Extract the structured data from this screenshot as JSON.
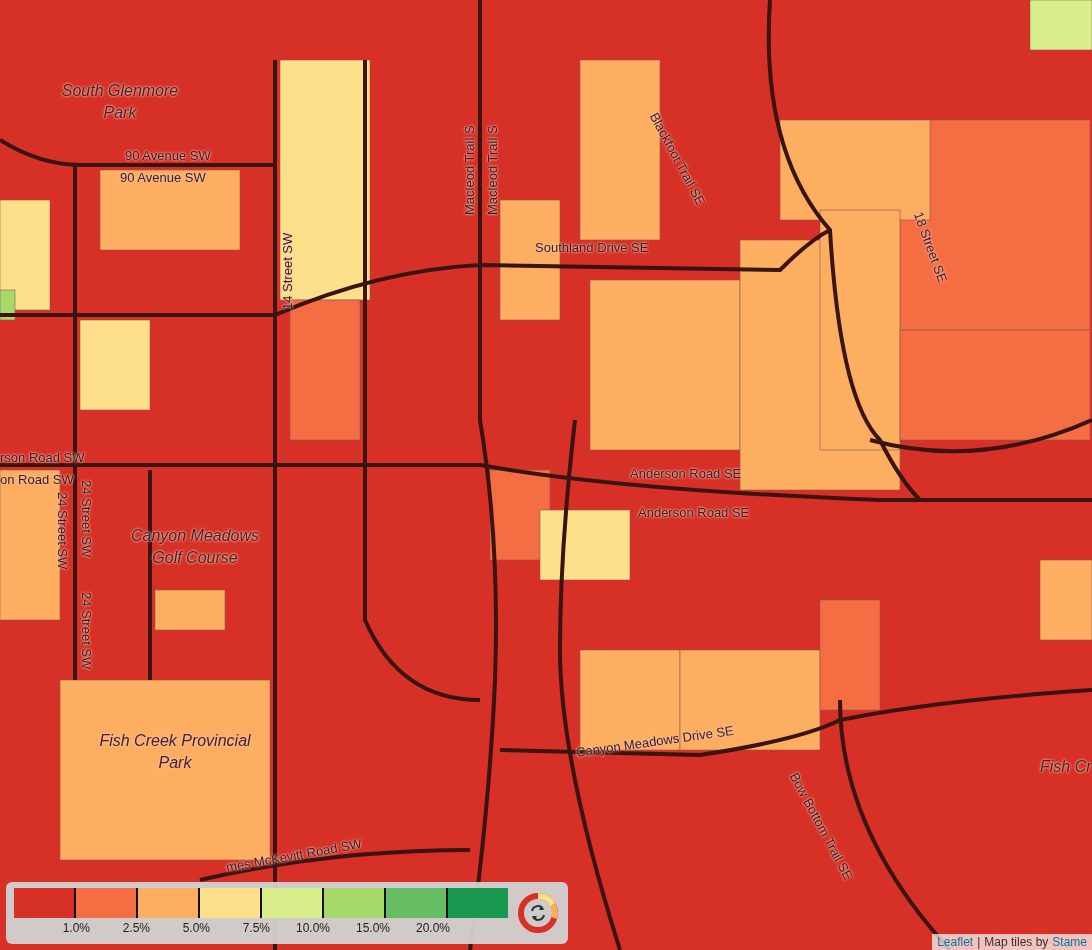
{
  "map": {
    "labels": [
      {
        "text": "South Glenmore Park",
        "kind": "park"
      },
      {
        "text": "90 Avenue SW",
        "kind": "road"
      },
      {
        "text": "90 Avenue SW",
        "kind": "road"
      },
      {
        "text": "14 Street SW",
        "kind": "road-vertical"
      },
      {
        "text": "Macleod Trail S",
        "kind": "road-vertical"
      },
      {
        "text": "Macleod Trail S",
        "kind": "road-vertical"
      },
      {
        "text": "Blackfoot Trail SE",
        "kind": "road-vertical"
      },
      {
        "text": "18 Street SE",
        "kind": "road-vertical"
      },
      {
        "text": "Southland Drive SE",
        "kind": "road"
      },
      {
        "text": "rson Road SW",
        "kind": "road"
      },
      {
        "text": "on Road SW",
        "kind": "road"
      },
      {
        "text": "24 Street SW",
        "kind": "road-vertical"
      },
      {
        "text": "24 Street SW",
        "kind": "road-vertical"
      },
      {
        "text": "24 Street SW",
        "kind": "road-vertical"
      },
      {
        "text": "Anderson Road SE",
        "kind": "road"
      },
      {
        "text": "Anderson Road SE",
        "kind": "road"
      },
      {
        "text": "Canyon Meadows Golf Course",
        "kind": "park"
      },
      {
        "text": "Fish Creek Provincial Park",
        "kind": "park"
      },
      {
        "text": "Canyon Meadows Drive SE",
        "kind": "road"
      },
      {
        "text": "Bow Bottom Trail SE",
        "kind": "road-vertical"
      },
      {
        "text": "Fish Cr",
        "kind": "park"
      },
      {
        "text": "mes McKevitt Road SW",
        "kind": "road"
      }
    ]
  },
  "legend": {
    "classes": [
      {
        "color": "#d73027",
        "label": "1.0%"
      },
      {
        "color": "#f46d43",
        "label": "2.5%"
      },
      {
        "color": "#fdae61",
        "label": "5.0%"
      },
      {
        "color": "#fee08b",
        "label": "7.5%"
      },
      {
        "color": "#d9ef8b",
        "label": "10.0%"
      },
      {
        "color": "#a6d96a",
        "label": "15.0%"
      },
      {
        "color": "#66bd63",
        "label": "20.0%"
      },
      {
        "color": "#1a9850"
      }
    ]
  },
  "attribution": {
    "links": [
      "Leaflet",
      "Stame"
    ],
    "separator": "|",
    "text": "Map tiles by"
  }
}
